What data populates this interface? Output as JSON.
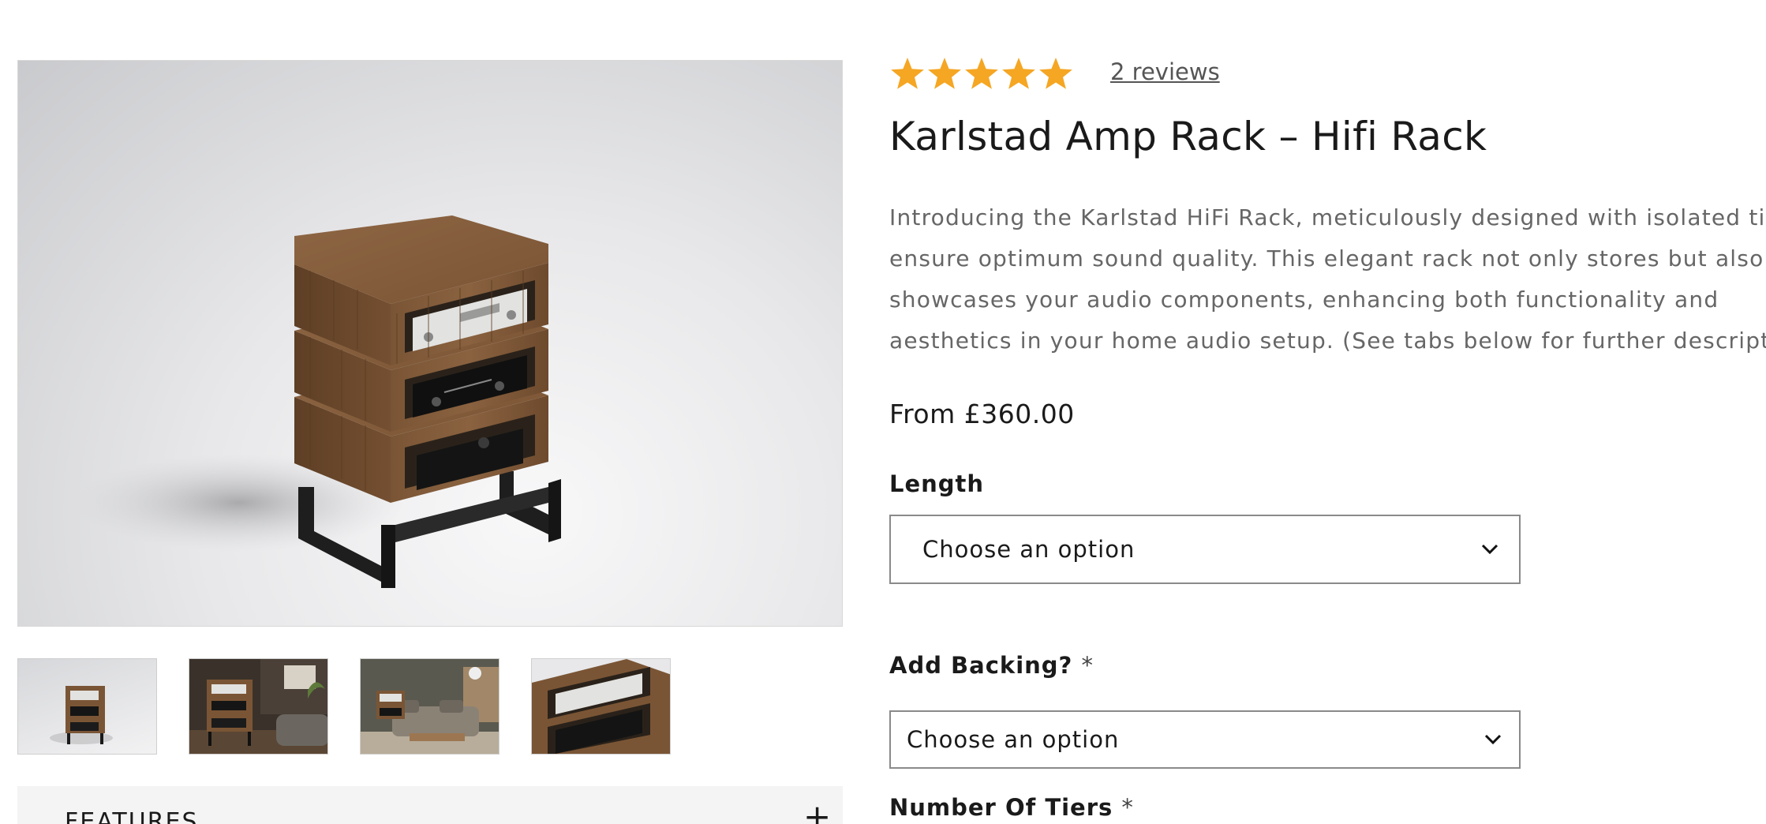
{
  "product": {
    "reviews_link": "2 reviews",
    "rating": 5,
    "rating_max": 5,
    "title": "Karlstad Amp Rack – Hifi Rack",
    "description_lines": [
      "Introducing the Karlstad HiFi Rack, meticulously designed with isolated ti",
      "ensure optimum sound quality. This elegant rack not only stores but also",
      "showcases your audio components, enhancing both functionality and",
      "aesthetics in your home audio setup. (See tabs below for further descripti"
    ],
    "price": "From £360.00"
  },
  "options": {
    "length": {
      "label": "Length",
      "value": "Choose an option"
    },
    "backing": {
      "label": "Add Backing?",
      "required_mark": "*",
      "value": "Choose an option"
    },
    "tiers": {
      "label": "Number Of Tiers",
      "required_mark": "*"
    }
  },
  "gallery": {
    "thumbnail_count": 4
  },
  "accordion": {
    "label": "FEATURES",
    "toggle": "+"
  },
  "colors": {
    "star": "#f5a623",
    "text": "#1a1a1a",
    "muted_text": "#666666",
    "border": "#8a8a8a",
    "accordion_bg": "#f4f4f4"
  }
}
